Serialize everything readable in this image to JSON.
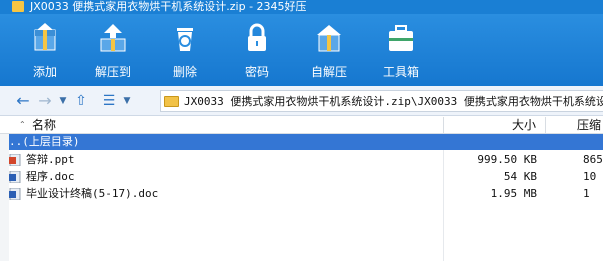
{
  "window": {
    "title": "JX0033 便携式家用衣物烘干机系统设计.zip - 2345好压"
  },
  "toolbar": {
    "items": [
      {
        "label": "添加",
        "icon": "add-archive-icon"
      },
      {
        "label": "解压到",
        "icon": "extract-icon"
      },
      {
        "label": "删除",
        "icon": "recycle-bin-icon"
      },
      {
        "label": "密码",
        "icon": "lock-icon"
      },
      {
        "label": "自解压",
        "icon": "self-extract-icon"
      },
      {
        "label": "工具箱",
        "icon": "toolbox-icon"
      }
    ]
  },
  "address": {
    "path": "JX0033 便携式家用衣物烘干机系统设计.zip\\JX0033 便携式家用衣物烘干机系统设计"
  },
  "columns": {
    "name": "名称",
    "size": "大小",
    "compressed": "压缩"
  },
  "rows": [
    {
      "name": "..(上层目录)",
      "size": "",
      "compressed": "",
      "icon": "parent-folder-icon"
    },
    {
      "name": "答辩.ppt",
      "size": "999.50 KB",
      "compressed": "865",
      "icon": "ppt-file-icon"
    },
    {
      "name": "程序.doc",
      "size": "54 KB",
      "compressed": "10",
      "icon": "word-file-icon"
    },
    {
      "name": "毕业设计终稿(5-17).doc",
      "size": "1.95 MB",
      "compressed": "1",
      "icon": "word-file-icon"
    }
  ],
  "colors": {
    "titlebar": "#1a7fd4",
    "toolbar": "#1e84d9",
    "selection": "#3476d4"
  }
}
